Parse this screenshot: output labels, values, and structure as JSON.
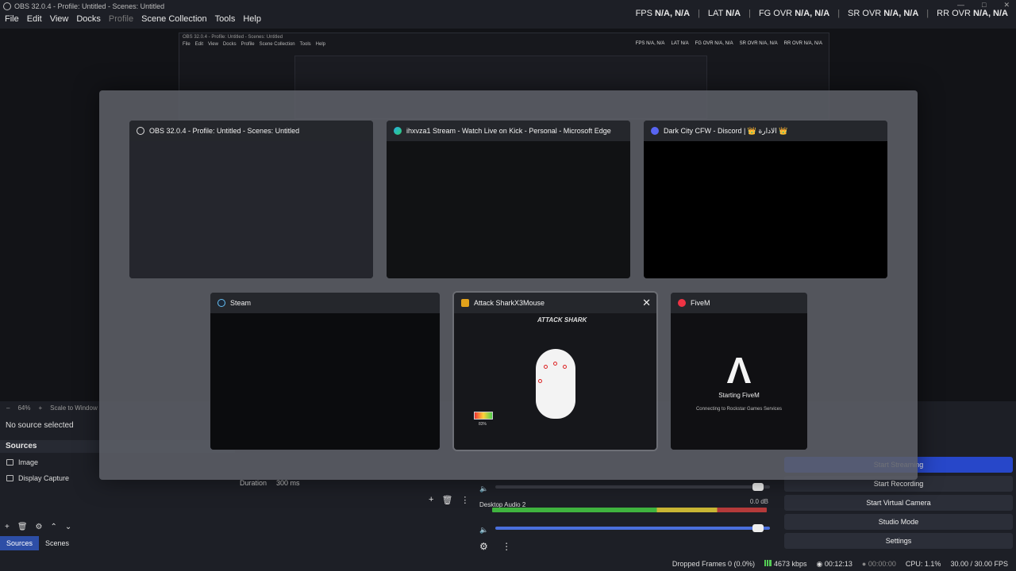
{
  "window": {
    "title": "OBS 32.0.4 - Profile: Untitled - Scenes: Untitled"
  },
  "menu": [
    "File",
    "Edit",
    "View",
    "Docks",
    "Profile",
    "Scene Collection",
    "Tools",
    "Help"
  ],
  "stats": {
    "fps_label": "FPS",
    "fps_value": "N/A, N/A",
    "lat_label": "LAT",
    "lat_value": "N/A",
    "fg_label": "FG OVR",
    "fg_value": "N/A, N/A",
    "sr_label": "SR OVR",
    "sr_value": "N/A, N/A",
    "rr_label": "RR OVR",
    "rr_value": "N/A, N/A"
  },
  "preview": {
    "zoom": "64%",
    "scale_label": "Scale to Window",
    "no_source": "No source selected"
  },
  "sources": {
    "header": "Sources",
    "items": [
      "Image",
      "Display Capture"
    ],
    "tab_sources": "Sources",
    "tab_scenes": "Scenes"
  },
  "filters": {
    "duration_label": "Duration",
    "duration_value": "300 ms"
  },
  "mixer": {
    "track2_name": "Desktop Audio 2",
    "track2_db": "0.0 dB"
  },
  "controls": {
    "start_streaming": "Start Streaming",
    "start_recording": "Start Recording",
    "start_virtual_camera": "Start Virtual Camera",
    "studio_mode": "Studio Mode",
    "settings": "Settings"
  },
  "status": {
    "dropped": "Dropped Frames 0 (0.0%)",
    "bitrate": "4673 kbps",
    "stream_time": "00:12:13",
    "rec_time": "00:00:00",
    "cpu": "CPU: 1.1%",
    "fps": "30.00 / 30.00 FPS"
  },
  "switcher": {
    "windows": [
      {
        "title": "OBS 32.0.4 - Profile: Untitled - Scenes: Untitled",
        "icon": "obs-icon"
      },
      {
        "title": "ihxvza1 Stream - Watch Live on Kick - Personal - Microsoft Edge",
        "icon": "edge-icon"
      },
      {
        "title": "Dark City CFW - Discord | 👑 الادارة 👑",
        "icon": "discord-icon"
      },
      {
        "title": "Steam",
        "icon": "steam-icon"
      },
      {
        "title": "Attack SharkX3Mouse",
        "icon": "attack-shark-icon"
      },
      {
        "title": "FiveM",
        "icon": "fivem-icon"
      }
    ],
    "fivem_starting": "Starting FiveM",
    "fivem_connecting": "Connecting to Rockstar Games Services",
    "attack_logo": "ATTACK SHARK",
    "battery": "83%"
  },
  "colors": {
    "accent": "#2747c9",
    "background": "#1d1f26"
  }
}
